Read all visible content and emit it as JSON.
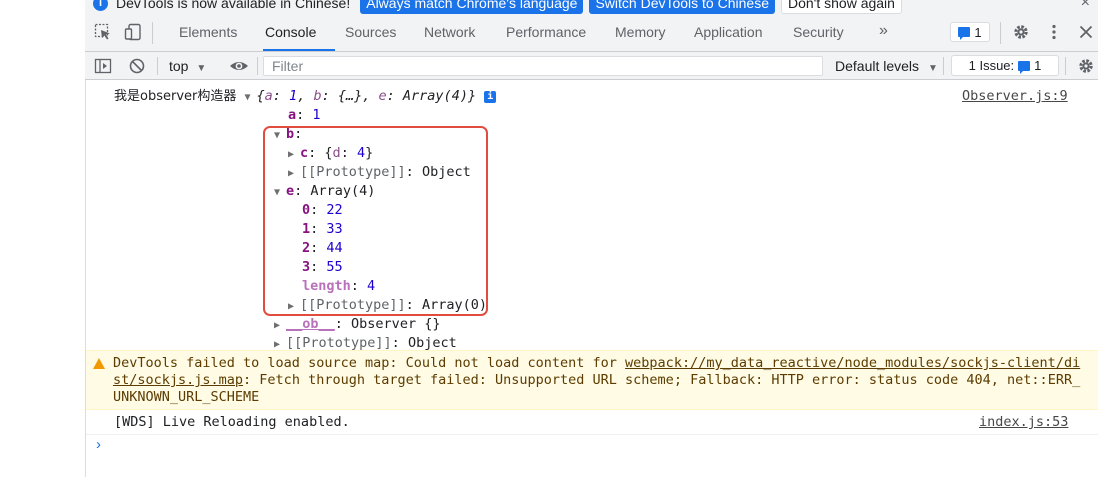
{
  "infobar": {
    "message": "DevTools is now available in Chinese!",
    "btn_match": "Always match Chrome's language",
    "btn_switch": "Switch DevTools to Chinese",
    "btn_dismiss": "Don't show again",
    "close": "×"
  },
  "tabs": [
    "Elements",
    "Console",
    "Sources",
    "Network",
    "Performance",
    "Memory",
    "Application",
    "Security"
  ],
  "more_tabs": "»",
  "active_tab": "Console",
  "messages_count": "1",
  "toolbar": {
    "context": "top",
    "filter_placeholder": "Filter",
    "levels": "Default levels",
    "issues_label": "1 Issue:",
    "issues_count": "1"
  },
  "log": {
    "prefix": "我是observer构造器",
    "summary_open": "{",
    "summary_a_key": "a",
    "summary_a_val": "1",
    "summary_b_key": "b",
    "summary_b_val": "{…}",
    "summary_e_key": "e",
    "summary_e_val": "Array(4)",
    "summary_close": "}",
    "info_badge": "i",
    "source": "Observer.js:9",
    "a_key": "a",
    "a_val": "1",
    "b_key": "b",
    "c_key": "c",
    "c_open": "{",
    "c_inner_key": "d",
    "c_inner_val": "4",
    "c_close": "}",
    "proto_key": "[[Prototype]]",
    "proto_object": "Object",
    "e_key": "e",
    "e_val": "Array(4)",
    "items": [
      {
        "index": "0",
        "value": "22"
      },
      {
        "index": "1",
        "value": "33"
      },
      {
        "index": "2",
        "value": "44"
      },
      {
        "index": "3",
        "value": "55"
      }
    ],
    "length_key": "length",
    "length_val": "4",
    "proto_array": "Array(0)",
    "ob_key": "__ob__",
    "ob_val": "Observer {}"
  },
  "warning": {
    "text_before": "DevTools failed to load source map: Could not load content for ",
    "url": "webpack://my_data_reactive/node_modules/sockjs-client/dist/sockjs.js.map",
    "text_after": ": Fetch through target failed: Unsupported URL scheme; Fallback: HTTP error: status code 404, net::ERR_UNKNOWN_URL_SCHEME"
  },
  "wds": {
    "text": "[WDS] Live Reloading enabled.",
    "source": "index.js:53"
  },
  "prompt": "›",
  "colors": {
    "accent": "#1a73e8",
    "warning_bg": "#fffbe5",
    "highlight_box": "#e04d3f"
  }
}
